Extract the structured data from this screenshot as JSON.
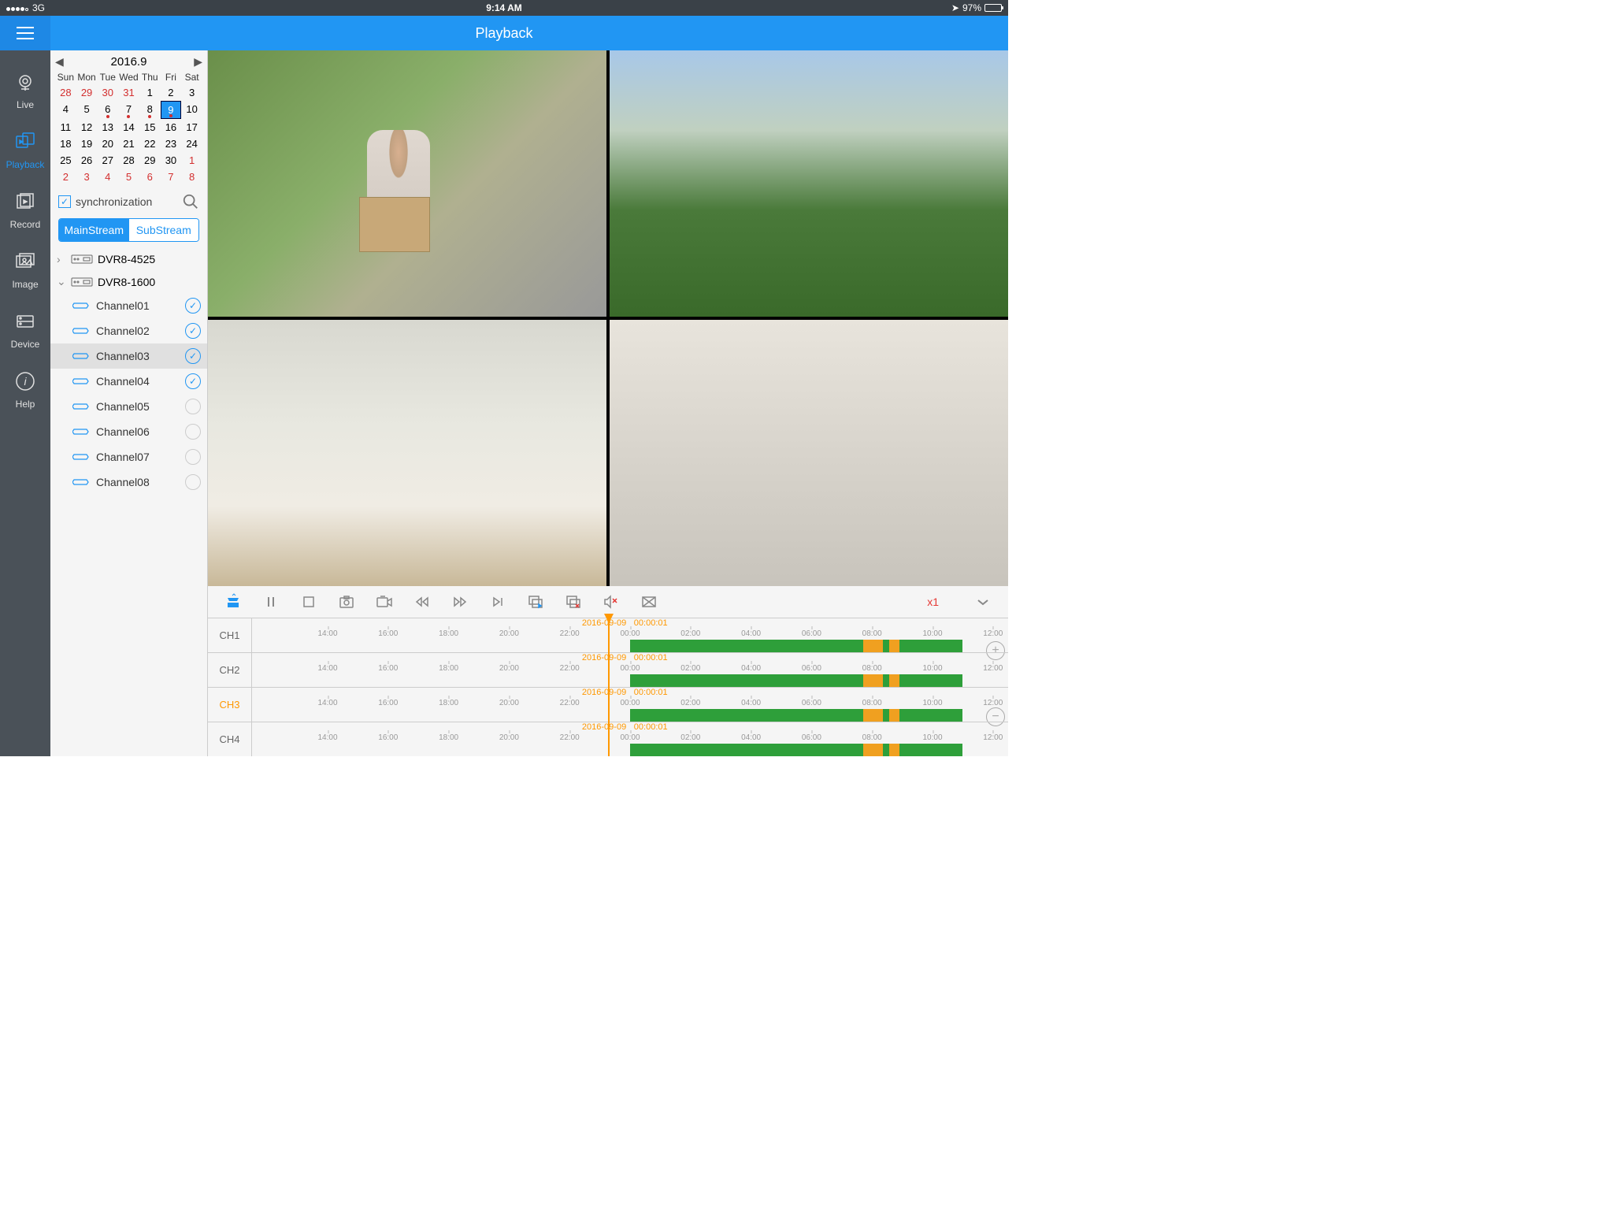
{
  "status": {
    "network": "3G",
    "time": "9:14 AM",
    "battery": "97%"
  },
  "header": {
    "title": "Playback"
  },
  "nav": {
    "items": [
      {
        "label": "Live"
      },
      {
        "label": "Playback"
      },
      {
        "label": "Record"
      },
      {
        "label": "Image"
      },
      {
        "label": "Device"
      },
      {
        "label": "Help"
      }
    ]
  },
  "calendar": {
    "title": "2016.9",
    "dow": [
      "Sun",
      "Mon",
      "Tue",
      "Wed",
      "Thu",
      "Fri",
      "Sat"
    ],
    "weeks": [
      [
        {
          "d": "28",
          "o": 1
        },
        {
          "d": "29",
          "o": 1
        },
        {
          "d": "30",
          "o": 1
        },
        {
          "d": "31",
          "o": 1
        },
        {
          "d": "1"
        },
        {
          "d": "2"
        },
        {
          "d": "3"
        }
      ],
      [
        {
          "d": "4"
        },
        {
          "d": "5"
        },
        {
          "d": "6",
          "dot": 1
        },
        {
          "d": "7",
          "dot": 1
        },
        {
          "d": "8",
          "dot": 1
        },
        {
          "d": "9",
          "sel": 1,
          "dot": 1
        },
        {
          "d": "10"
        }
      ],
      [
        {
          "d": "11"
        },
        {
          "d": "12"
        },
        {
          "d": "13"
        },
        {
          "d": "14"
        },
        {
          "d": "15"
        },
        {
          "d": "16"
        },
        {
          "d": "17"
        }
      ],
      [
        {
          "d": "18"
        },
        {
          "d": "19"
        },
        {
          "d": "20"
        },
        {
          "d": "21"
        },
        {
          "d": "22"
        },
        {
          "d": "23"
        },
        {
          "d": "24"
        }
      ],
      [
        {
          "d": "25"
        },
        {
          "d": "26"
        },
        {
          "d": "27"
        },
        {
          "d": "28"
        },
        {
          "d": "29"
        },
        {
          "d": "30"
        },
        {
          "d": "1",
          "o": 1
        }
      ],
      [
        {
          "d": "2",
          "o": 1
        },
        {
          "d": "3",
          "o": 1
        },
        {
          "d": "4",
          "o": 1
        },
        {
          "d": "5",
          "o": 1
        },
        {
          "d": "6",
          "o": 1
        },
        {
          "d": "7",
          "o": 1
        },
        {
          "d": "8",
          "o": 1
        }
      ]
    ]
  },
  "sync": {
    "label": "synchronization",
    "checked": true
  },
  "stream": {
    "main": "MainStream",
    "sub": "SubStream",
    "active": "main"
  },
  "devices": [
    {
      "name": "DVR8-4525",
      "expanded": false
    },
    {
      "name": "DVR8-1600",
      "expanded": true,
      "channels": [
        {
          "name": "Channel01",
          "checked": true
        },
        {
          "name": "Channel02",
          "checked": true
        },
        {
          "name": "Channel03",
          "checked": true,
          "hl": true
        },
        {
          "name": "Channel04",
          "checked": true
        },
        {
          "name": "Channel05",
          "checked": false
        },
        {
          "name": "Channel06",
          "checked": false
        },
        {
          "name": "Channel07",
          "checked": false
        },
        {
          "name": "Channel08",
          "checked": false
        }
      ]
    }
  ],
  "controls": {
    "speed": "x1"
  },
  "timeline": {
    "ticks": [
      "14:00",
      "16:00",
      "18:00",
      "20:00",
      "22:00",
      "00:00",
      "02:00",
      "04:00",
      "06:00",
      "08:00",
      "10:00",
      "12:00"
    ],
    "rows": [
      {
        "ch": "CH1",
        "date": "2016-09-09",
        "time": "00:00:01"
      },
      {
        "ch": "CH2",
        "date": "2016-09-09",
        "time": "00:00:01"
      },
      {
        "ch": "CH3",
        "date": "2016-09-09",
        "time": "00:00:01",
        "active": true
      },
      {
        "ch": "CH4",
        "date": "2016-09-09",
        "time": "00:00:01"
      }
    ]
  }
}
